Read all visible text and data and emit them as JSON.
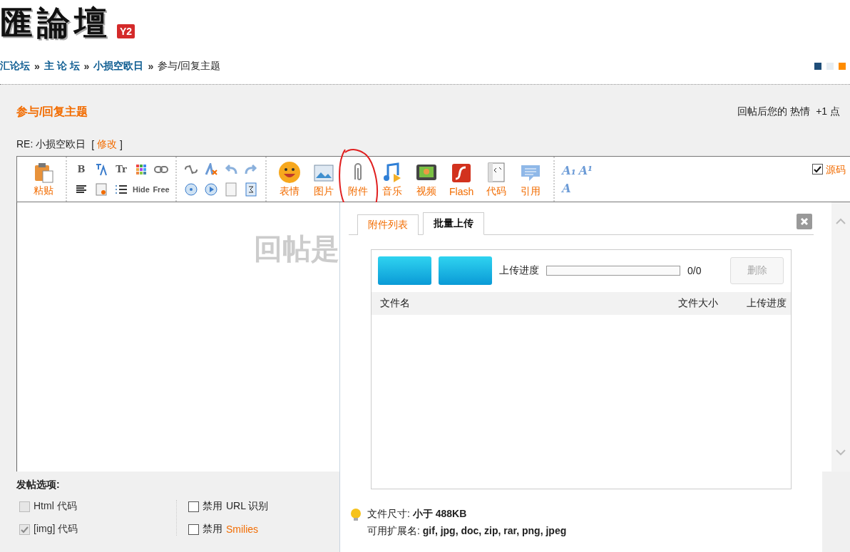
{
  "logo": {
    "text": "匯論壇",
    "badge": "Y2"
  },
  "breadcrumb": [
    {
      "label": "汇论坛",
      "kind": "link"
    },
    {
      "sep": "»",
      "label": "主 论 坛",
      "kind": "link"
    },
    {
      "sep": "»",
      "label": "小损空欧日",
      "kind": "link"
    },
    {
      "sep": "»",
      "label": "参与/回复主题",
      "kind": "current"
    }
  ],
  "style_swatches": [
    {
      "color": "#1f4e79"
    },
    {
      "color": "#e6edf3"
    },
    {
      "color": "#ff8c00"
    }
  ],
  "page_title": "参与/回复主题",
  "reward": {
    "prefix": "回帖后您的",
    "name": "热情",
    "amount": "+1 点"
  },
  "subject": {
    "text": "RE: 小损空欧日",
    "bracket_open": "[",
    "edit_link": "修改",
    "bracket_close": "]"
  },
  "toolbar": {
    "paste": "粘贴",
    "format_tools": [
      {
        "kind": "glyph",
        "text": "B"
      },
      {
        "kind": "icon"
      },
      {
        "kind": "glyph",
        "text": "Tr"
      },
      {
        "kind": "icon"
      },
      {
        "kind": "icon"
      },
      {
        "kind": "icon"
      },
      {
        "kind": "icon"
      },
      {
        "kind": "icon"
      },
      {
        "kind": "glyph",
        "text": "Hide"
      },
      {
        "kind": "glyph",
        "text": "Free"
      }
    ],
    "big_tools": [
      {
        "kind": "smiley",
        "label": "表情",
        "annotated": false
      },
      {
        "kind": "image",
        "label": "图片",
        "annotated": false
      },
      {
        "kind": "attach",
        "label": "附件",
        "annotated": true
      },
      {
        "kind": "music",
        "label": "音乐",
        "annotated": false
      },
      {
        "kind": "video",
        "label": "视频",
        "annotated": false
      },
      {
        "kind": "flash",
        "label": "Flash",
        "annotated": false
      },
      {
        "kind": "code",
        "label": "代码",
        "annotated": false
      },
      {
        "kind": "quote",
        "label": "引用",
        "annotated": false
      }
    ],
    "size_tools": [
      "A₁",
      "A¹",
      "A"
    ],
    "source": {
      "label": "源码",
      "checked": true
    }
  },
  "editor": {
    "watermark": "回帖是"
  },
  "upload_panel": {
    "tabs": [
      {
        "label": "附件列表",
        "selected": false
      },
      {
        "label": "批量上传",
        "selected": true
      }
    ],
    "progress_label": "上传进度",
    "level": 0,
    "count": "0/0",
    "delete": {
      "label": "删除",
      "disabled": true
    },
    "columns": [
      "文件名",
      "文件大小",
      "上传进度"
    ],
    "size_label": "文件尺寸:",
    "size_value": "小于  488KB",
    "ext_label": "可用扩展名:",
    "ext_value": "gif, jpg, doc, zip, rar, png, jpeg"
  },
  "options": {
    "title": "发帖选项:",
    "left": [
      {
        "label": "Html 代码",
        "checked": false,
        "disabled": true
      },
      {
        "label": "[img] 代码",
        "checked": true,
        "disabled": true
      }
    ],
    "right": [
      {
        "prefix": "禁用",
        "label": "URL 识别",
        "kind": "plain",
        "checked": false
      },
      {
        "prefix": "禁用",
        "label": "Smilies",
        "kind": "link",
        "checked": false
      }
    ]
  }
}
